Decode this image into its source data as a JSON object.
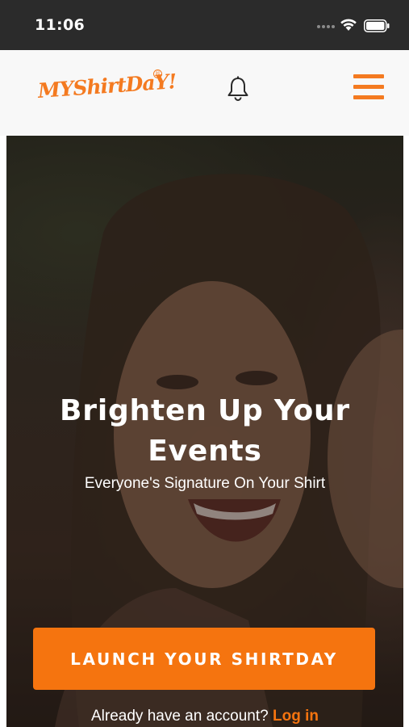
{
  "status_bar": {
    "time": "11:06",
    "icons": [
      "signal-icon",
      "wifi-icon",
      "battery-icon"
    ]
  },
  "header": {
    "logo_text": "MYShirtDaY!",
    "logo_mark": "®",
    "icons": [
      "bell-icon",
      "hamburger-menu-icon"
    ],
    "accent_color": "#f47a20",
    "background_color": "#f8f8f8"
  },
  "hero": {
    "title_line1": "Brighten Up Your",
    "title_line2": "Events",
    "subtitle": "Everyone's Signature On Your Shirt",
    "cta_label": "LAUNCH YOUR SHIRTDAY",
    "cta_color": "#f5740f",
    "login_prompt": "Already have an account?",
    "login_link": "Log in"
  }
}
